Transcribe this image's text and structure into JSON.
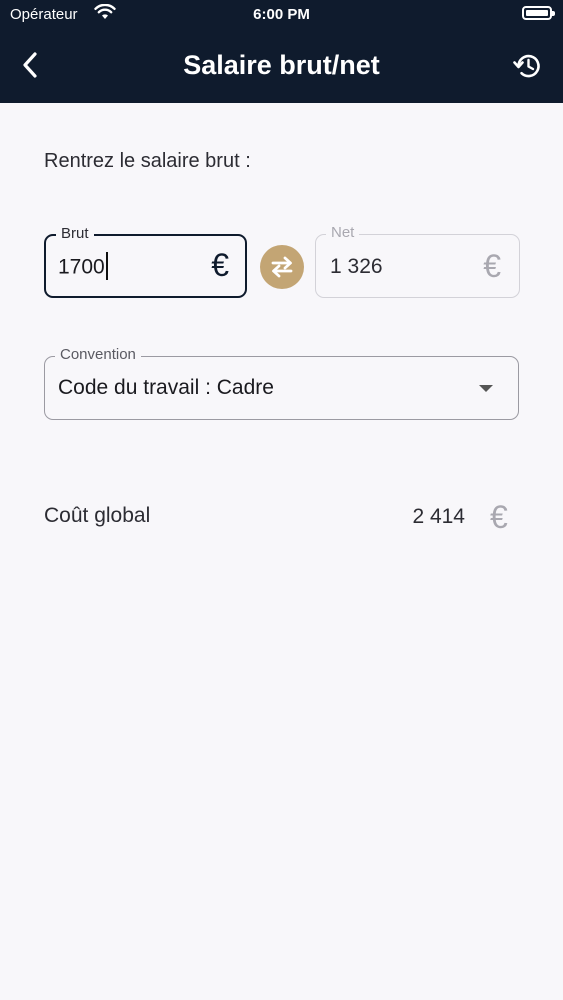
{
  "status_bar": {
    "carrier": "Opérateur",
    "time": "6:00 PM"
  },
  "nav": {
    "title": "Salaire brut/net",
    "back_icon": "chevron-left-icon",
    "reset_icon": "history-reset-icon"
  },
  "form": {
    "prompt": "Rentrez le salaire brut :",
    "brut": {
      "label": "Brut",
      "value": "1700",
      "currency": "€"
    },
    "net": {
      "label": "Net",
      "value": "1 326",
      "currency": "€"
    },
    "swap_icon": "swap-arrows-icon",
    "convention": {
      "label": "Convention",
      "value": "Code du travail : Cadre"
    }
  },
  "summary": {
    "cost_label": "Coût global",
    "cost_value": "2 414",
    "currency": "€"
  },
  "colors": {
    "nav_background": "#0f1b2d",
    "accent_gold": "#c3a574",
    "page_background": "#f8f7fa",
    "muted_text": "#a9a8b0"
  }
}
